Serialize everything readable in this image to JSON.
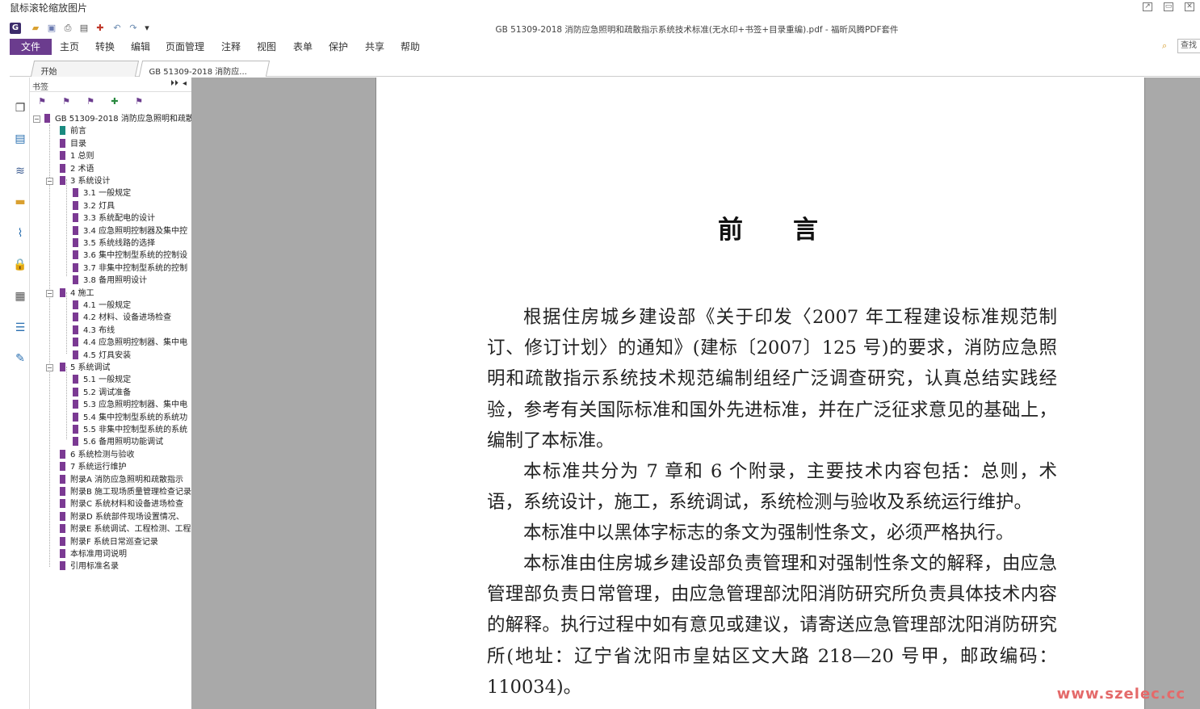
{
  "window": {
    "caption": "鼠标滚轮缩放图片",
    "doc_title": "GB 51309-2018 消防应急照明和疏散指示系统技术标准(无水印+书签+目录重编).pdf - 福昕风腾PDF套件"
  },
  "ribbon": {
    "file": "文件",
    "menus": [
      "主页",
      "转换",
      "编辑",
      "页面管理",
      "注释",
      "视图",
      "表单",
      "保护",
      "共享",
      "帮助"
    ],
    "search_label": "查找"
  },
  "tabs": [
    {
      "label": "开始"
    },
    {
      "label": "GB 51309-2018 消防应...",
      "close": "×"
    }
  ],
  "bookmarks": {
    "title": "书签",
    "root": "GB 51309-2018 消防应急照明和疏散",
    "items": [
      "前言",
      "目录",
      "1 总则",
      "2 术语",
      "3 系统设计",
      "3.1 一般规定",
      "3.2 灯具",
      "3.3 系统配电的设计",
      "3.4 应急照明控制器及集中控",
      "3.5 系统线路的选择",
      "3.6 集中控制型系统的控制设",
      "3.7 非集中控制型系统的控制",
      "3.8 备用照明设计",
      "4 施工",
      "4.1 一般规定",
      "4.2 材料、设备进场检查",
      "4.3 布线",
      "4.4 应急照明控制器、集中电",
      "4.5 灯具安装",
      "5 系统调试",
      "5.1 一般规定",
      "5.2 调试准备",
      "5.3 应急照明控制器、集中电",
      "5.4 集中控制型系统的系统功",
      "5.5 非集中控制型系统的系统",
      "5.6 备用照明功能调试",
      "6 系统检测与验收",
      "7 系统运行维护",
      "附录A 消防应急照明和疏散指示",
      "附录B 施工现场质量管理检查记录",
      "附录C 系统材料和设备进场检查",
      "附录D 系统部件现场设置情况、",
      "附录E 系统调试、工程检测、工程",
      "附录F 系统日常巡查记录",
      "本标准用词说明",
      "引用标准名录"
    ]
  },
  "document": {
    "heading": "前言",
    "paragraphs": [
      "根据住房城乡建设部《关于印发〈2007 年工程建设标准规范制订、修订计划〉的通知》(建标〔2007〕125 号)的要求，消防应急照明和疏散指示系统技术规范编制组经广泛调查研究，认真总结实践经验，参考有关国际标准和国外先进标准，并在广泛征求意见的基础上，编制了本标准。",
      "本标准共分为 7 章和 6 个附录，主要技术内容包括：总则，术语，系统设计，施工，系统调试，系统检测与验收及系统运行维护。",
      "本标准中以黑体字标志的条文为强制性条文，必须严格执行。",
      "本标准由住房城乡建设部负责管理和对强制性条文的解释，由应急管理部负责日常管理，由应急管理部沈阳消防研究所负责具体技术内容的解释。执行过程中如有意见或建议，请寄送应急管理部沈阳消防研究所(地址：辽宁省沈阳市皇姑区文大路 218—20 号甲，邮政编码：110034)。"
    ],
    "watermark": "www.szelec.cc"
  }
}
